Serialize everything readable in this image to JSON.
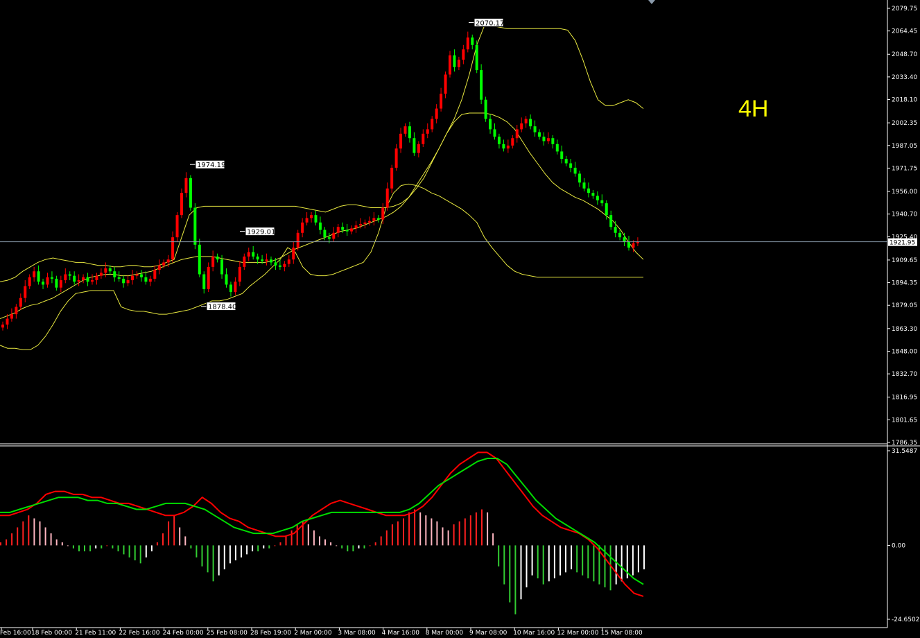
{
  "chart_data": {
    "type": "candlestick",
    "timeframe_label": "4H",
    "price_axis": {
      "ticks": [
        "2079.75",
        "2064.45",
        "2048.70",
        "2033.40",
        "2018.10",
        "2002.35",
        "1987.05",
        "1971.75",
        "1956.00",
        "1940.70",
        "1925.40",
        "1909.65",
        "1894.35",
        "1879.05",
        "1863.30",
        "1848.00",
        "1832.70",
        "1816.95",
        "1801.65",
        "1786.35"
      ],
      "range": [
        1786.35,
        2079.75
      ]
    },
    "current_price": "1921.95",
    "time_axis": [
      "Feb 16:00",
      "18 Feb 00:00",
      "21 Feb 11:00",
      "22 Feb 16:00",
      "24 Feb 00:00",
      "25 Feb 08:00",
      "28 Feb 19:00",
      "2 Mar 00:00",
      "3 Mar 08:00",
      "4 Mar 16:00",
      "8 Mar 00:00",
      "9 Mar 08:00",
      "10 Mar 16:00",
      "12 Mar 00:00",
      "15 Mar 08:00"
    ],
    "annotations": [
      {
        "label": "1974.19",
        "price": 1974.19
      },
      {
        "label": "1929.01",
        "price": 1929.01
      },
      {
        "label": "1878.40",
        "price": 1878.4
      },
      {
        "label": "2070.17",
        "price": 2070.17
      }
    ],
    "closes": [
      1866,
      1870,
      1873,
      1878,
      1884,
      1892,
      1898,
      1902,
      1895,
      1893,
      1898,
      1897,
      1891,
      1896,
      1900,
      1899,
      1895,
      1896,
      1898,
      1895,
      1896,
      1899,
      1901,
      1904,
      1902,
      1898,
      1897,
      1894,
      1896,
      1899,
      1900,
      1898,
      1895,
      1897,
      1903,
      1906,
      1908,
      1910,
      1925,
      1940,
      1955,
      1965,
      1945,
      1920,
      1900,
      1890,
      1905,
      1912,
      1910,
      1900,
      1893,
      1888,
      1895,
      1905,
      1912,
      1915,
      1912,
      1910,
      1909,
      1910,
      1908,
      1906,
      1905,
      1907,
      1910,
      1918,
      1928,
      1935,
      1938,
      1940,
      1935,
      1930,
      1925,
      1924,
      1928,
      1932,
      1930,
      1929,
      1931,
      1933,
      1934,
      1935,
      1936,
      1938,
      1937,
      1945,
      1958,
      1972,
      1985,
      1995,
      2000,
      1992,
      1982,
      1988,
      1995,
      1998,
      2005,
      2012,
      2022,
      2035,
      2048,
      2040,
      2045,
      2052,
      2060,
      2055,
      2038,
      2018,
      2005,
      1998,
      1993,
      1988,
      1985,
      1987,
      1992,
      1998,
      2002,
      2005,
      2000,
      1996,
      1993,
      1990,
      1992,
      1988,
      1983,
      1978,
      1975,
      1972,
      1968,
      1962,
      1958,
      1955,
      1953,
      1950,
      1948,
      1940,
      1932,
      1928,
      1925,
      1922,
      1918,
      1921,
      1922
    ],
    "bollinger": {
      "upper": [
        1895,
        1896,
        1898,
        1902,
        1905,
        1908,
        1910,
        1911,
        1910,
        1909,
        1908,
        1908,
        1907,
        1906,
        1906,
        1905,
        1905,
        1906,
        1906,
        1905,
        1905,
        1906,
        1908,
        1910,
        1925,
        1940,
        1945,
        1946,
        1946,
        1946,
        1946,
        1946,
        1946,
        1946,
        1946,
        1946,
        1946,
        1946,
        1946,
        1946,
        1945,
        1944,
        1943,
        1942,
        1944,
        1946,
        1947,
        1947,
        1946,
        1945,
        1945,
        1945,
        1946,
        1948,
        1952,
        1958,
        1965,
        1975,
        1985,
        1995,
        2005,
        2018,
        2035,
        2055,
        2068,
        2068,
        2067,
        2066,
        2066,
        2066,
        2066,
        2066,
        2066,
        2066,
        2066,
        2065,
        2058,
        2045,
        2030,
        2018,
        2014,
        2014,
        2016,
        2018,
        2016,
        2012
      ],
      "mid": [
        1870,
        1872,
        1874,
        1877,
        1879,
        1880,
        1882,
        1884,
        1887,
        1890,
        1893,
        1896,
        1898,
        1899,
        1900,
        1900,
        1899,
        1899,
        1900,
        1901,
        1902,
        1904,
        1906,
        1908,
        1910,
        1911,
        1912,
        1912,
        1912,
        1911,
        1910,
        1909,
        1908,
        1908,
        1908,
        1908,
        1909,
        1911,
        1914,
        1917,
        1919,
        1921,
        1923,
        1925,
        1927,
        1929,
        1930,
        1931,
        1933,
        1935,
        1937,
        1939,
        1942,
        1946,
        1952,
        1960,
        1968,
        1976,
        1985,
        1995,
        2003,
        2008,
        2009,
        2009,
        2009,
        2008,
        2006,
        2003,
        1998,
        1990,
        1982,
        1975,
        1968,
        1962,
        1958,
        1955,
        1952,
        1950,
        1947,
        1944,
        1940,
        1936,
        1930,
        1922,
        1915,
        1910
      ],
      "lower": [
        1852,
        1850,
        1850,
        1849,
        1849,
        1852,
        1858,
        1866,
        1875,
        1882,
        1887,
        1888,
        1889,
        1889,
        1889,
        1889,
        1878,
        1876,
        1875,
        1875,
        1874,
        1873,
        1873,
        1874,
        1875,
        1876,
        1878,
        1880,
        1882,
        1882,
        1883,
        1885,
        1887,
        1892,
        1896,
        1900,
        1905,
        1910,
        1918,
        1915,
        1905,
        1900,
        1899,
        1899,
        1900,
        1902,
        1904,
        1906,
        1908,
        1915,
        1928,
        1945,
        1955,
        1960,
        1961,
        1960,
        1958,
        1955,
        1953,
        1950,
        1947,
        1944,
        1940,
        1935,
        1925,
        1918,
        1912,
        1906,
        1902,
        1900,
        1899,
        1898,
        1898,
        1898,
        1898,
        1898,
        1898,
        1898,
        1898,
        1898,
        1898,
        1898,
        1898,
        1898,
        1898,
        1898
      ]
    },
    "macd": {
      "axis_ticks": [
        "31.5487",
        "0.00",
        "-24.6502"
      ],
      "range": [
        -24.6502,
        31.5487
      ],
      "histogram": [
        1,
        2,
        4,
        6,
        8,
        10,
        9,
        8,
        6,
        4,
        2,
        1,
        0,
        -1,
        -2,
        -2,
        -2,
        -1,
        -1,
        0,
        -1,
        -2,
        -3,
        -4,
        -5,
        -6,
        -4,
        -2,
        1,
        4,
        8,
        10,
        6,
        3,
        -1,
        -4,
        -7,
        -9,
        -12,
        -10,
        -8,
        -6,
        -5,
        -4,
        -3,
        -2,
        -2,
        -1,
        -1,
        0,
        1,
        3,
        5,
        7,
        8,
        7,
        5,
        3,
        2,
        1,
        0,
        -1,
        -2,
        -2,
        -1,
        -1,
        0,
        1,
        3,
        5,
        7,
        8,
        9,
        11,
        12,
        11,
        10,
        9,
        8,
        6,
        5,
        7,
        8,
        9,
        10,
        11,
        12,
        11,
        4,
        -7,
        -13,
        -19,
        -23,
        -18,
        -14,
        -10,
        -11,
        -13,
        -12,
        -11,
        -10,
        -9,
        -8,
        -9,
        -10,
        -11,
        -12,
        -13,
        -14,
        -15,
        -13,
        -12,
        -11,
        -10,
        -9,
        -8
      ],
      "macd_line": [
        10,
        10,
        11,
        12,
        14,
        17,
        18,
        18,
        17,
        17,
        16,
        16,
        15,
        14,
        14,
        13,
        12,
        11,
        10,
        10,
        11,
        13,
        16,
        14,
        11,
        9,
        8,
        6,
        5,
        4,
        3,
        3,
        4,
        7,
        10,
        12,
        14,
        15,
        14,
        13,
        12,
        11,
        10,
        10,
        10,
        11,
        13,
        16,
        20,
        24,
        27,
        29,
        31,
        31,
        29,
        25,
        21,
        17,
        13,
        10,
        8,
        6,
        5,
        4,
        2,
        -1,
        -5,
        -9,
        -13,
        -16,
        -17
      ],
      "signal_line": [
        11,
        11,
        12,
        13,
        14,
        15,
        16,
        16,
        16,
        15,
        15,
        14,
        14,
        13,
        12,
        12,
        13,
        14,
        14,
        14,
        13,
        12,
        10,
        8,
        6,
        5,
        4,
        4,
        4,
        5,
        6,
        8,
        9,
        10,
        11,
        11,
        11,
        11,
        11,
        11,
        11,
        11,
        12,
        14,
        17,
        20,
        22,
        24,
        26,
        28,
        29,
        29,
        27,
        23,
        19,
        15,
        12,
        9,
        7,
        5,
        3,
        1,
        -2,
        -5,
        -8,
        -11,
        -13
      ]
    }
  }
}
